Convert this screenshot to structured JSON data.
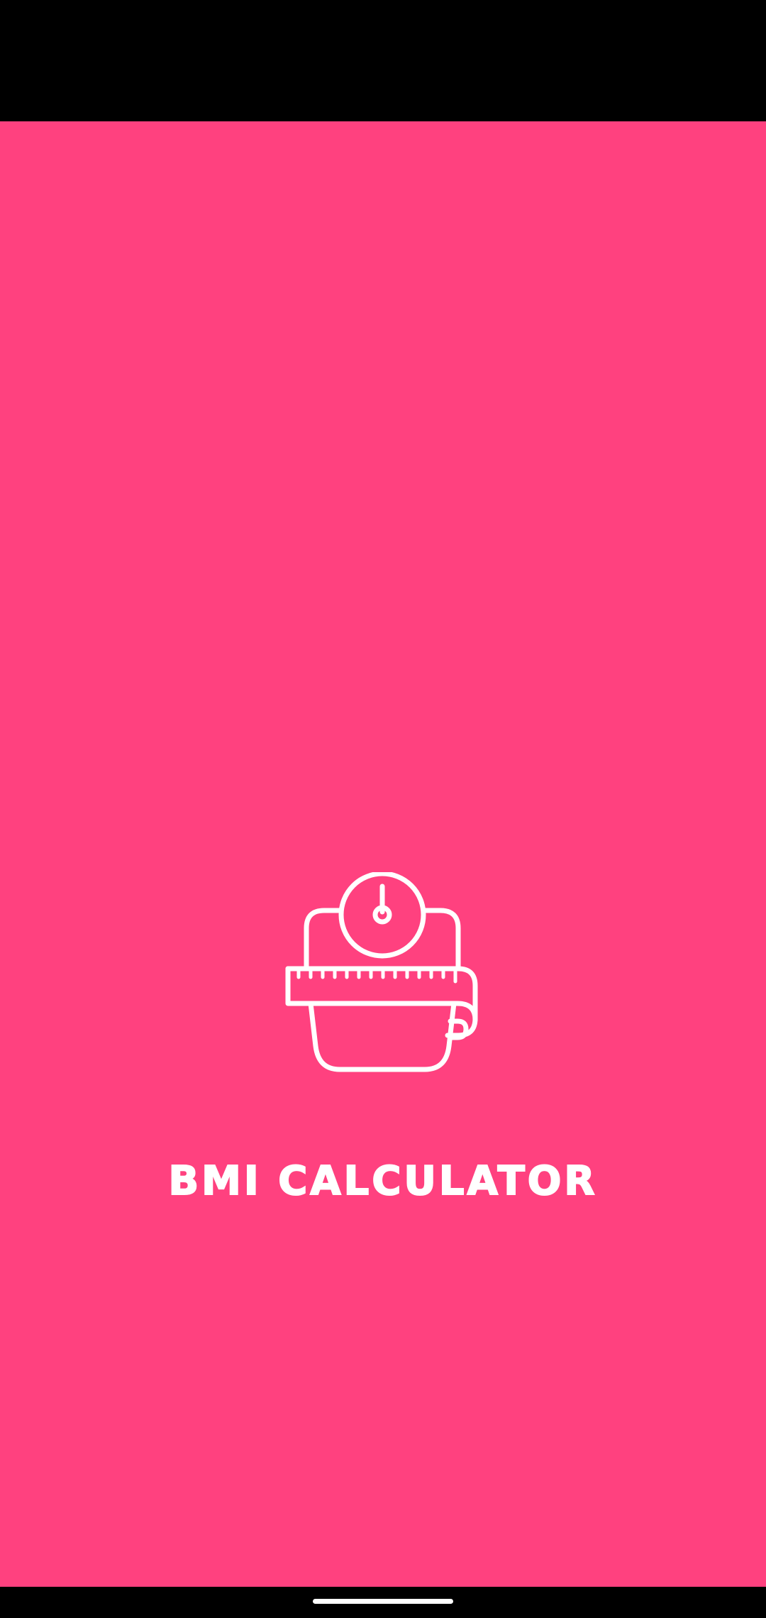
{
  "app": {
    "title": "BMI CALCULATOR",
    "logo_icon": "scale-with-measuring-tape-icon"
  },
  "colors": {
    "splash_background": "#FF417F",
    "foreground": "#FFFFFF",
    "system_bars": "#000000"
  }
}
